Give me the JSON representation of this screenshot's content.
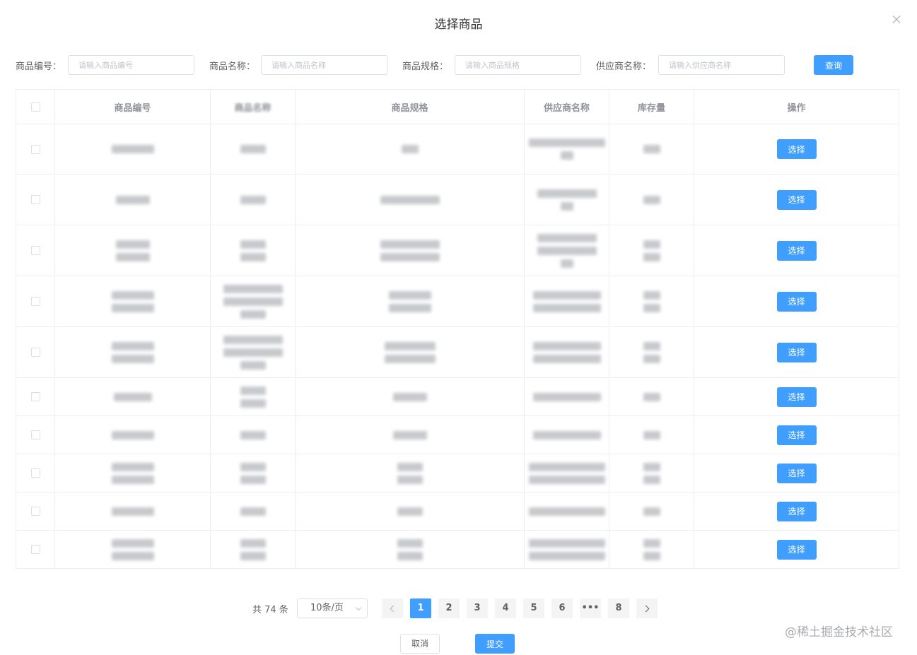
{
  "dialog": {
    "title": "选择商品"
  },
  "search": {
    "fields": [
      {
        "label": "商品编号：",
        "placeholder": "请输入商品编号"
      },
      {
        "label": "商品名称：",
        "placeholder": "请输入商品名称"
      },
      {
        "label": "商品规格：",
        "placeholder": "请输入商品规格"
      },
      {
        "label": "供应商名称：",
        "placeholder": "请输入供应商名称"
      }
    ],
    "query_label": "查询"
  },
  "table": {
    "headers": [
      "商品编号",
      "商品名称",
      "商品规格",
      "供应商名称",
      "库存量",
      "操作"
    ],
    "action_label": "选择",
    "row_count": 10
  },
  "pagination": {
    "total_text": "共 74 条",
    "page_size": "10条/页",
    "pages": [
      "1",
      "2",
      "3",
      "4",
      "5",
      "6",
      "•••",
      "8"
    ],
    "current": "1"
  },
  "footer": {
    "cancel_label": "取消",
    "submit_label": "提交"
  },
  "watermark": "@稀土掘金技术社区",
  "colors": {
    "primary": "#409eff",
    "border": "#ebeef5",
    "text": "#606266"
  }
}
